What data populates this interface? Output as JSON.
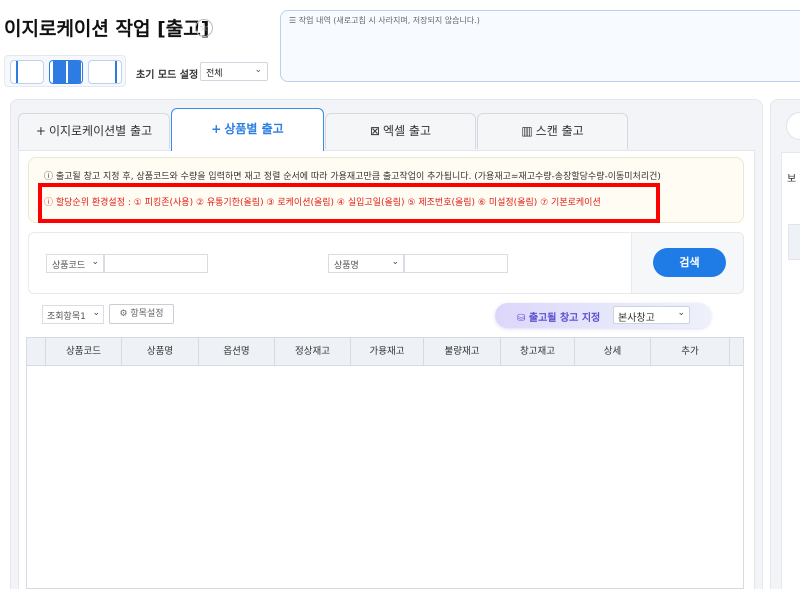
{
  "header": {
    "title": "이지로케이션 작업 [출고]",
    "memo_placeholder": "작업 내역 (새로고침 시 사라지며, 저장되지 않습니다.)"
  },
  "mode": {
    "label": "초기 모드 설정",
    "value": "전체"
  },
  "tabs": [
    {
      "icon": "+",
      "label": "이지로케이션별 출고"
    },
    {
      "icon": "+",
      "label": "상품별 출고"
    },
    {
      "icon": "⊠",
      "label": "엑셀 출고"
    },
    {
      "icon": "▥",
      "label": "스캔 출고"
    }
  ],
  "notice": {
    "line1": "출고될 창고 지정 후, 상품코드와 수량을 입력하면 재고 정렬 순서에 따라 가용재고만큼 출고작업이 추가됩니다. (가용재고=재고수량-송장할당수량-이동미처리건)",
    "line2": "할당순위 환경설정 : ① 피킹존(사용) ② 유통기한(올림) ③ 로케이션(올림) ④ 실입고일(올림) ⑤ 제조번호(올림) ⑥ 미설정(올림) ⑦ 기본로케이션"
  },
  "search": {
    "field1": "상품코드",
    "field2": "상품명",
    "button": "검색"
  },
  "toolbar": {
    "view": "조회항목1",
    "columns_button": "항목설정",
    "warehouse_label": "출고될 창고 지정",
    "warehouse_value": "본사창고"
  },
  "grid": {
    "columns": [
      "상품코드",
      "상품명",
      "옵션명",
      "정상재고",
      "가용재고",
      "불량재고",
      "창고재고",
      "상세",
      "추가"
    ]
  },
  "right_panel": {
    "label": "보"
  }
}
